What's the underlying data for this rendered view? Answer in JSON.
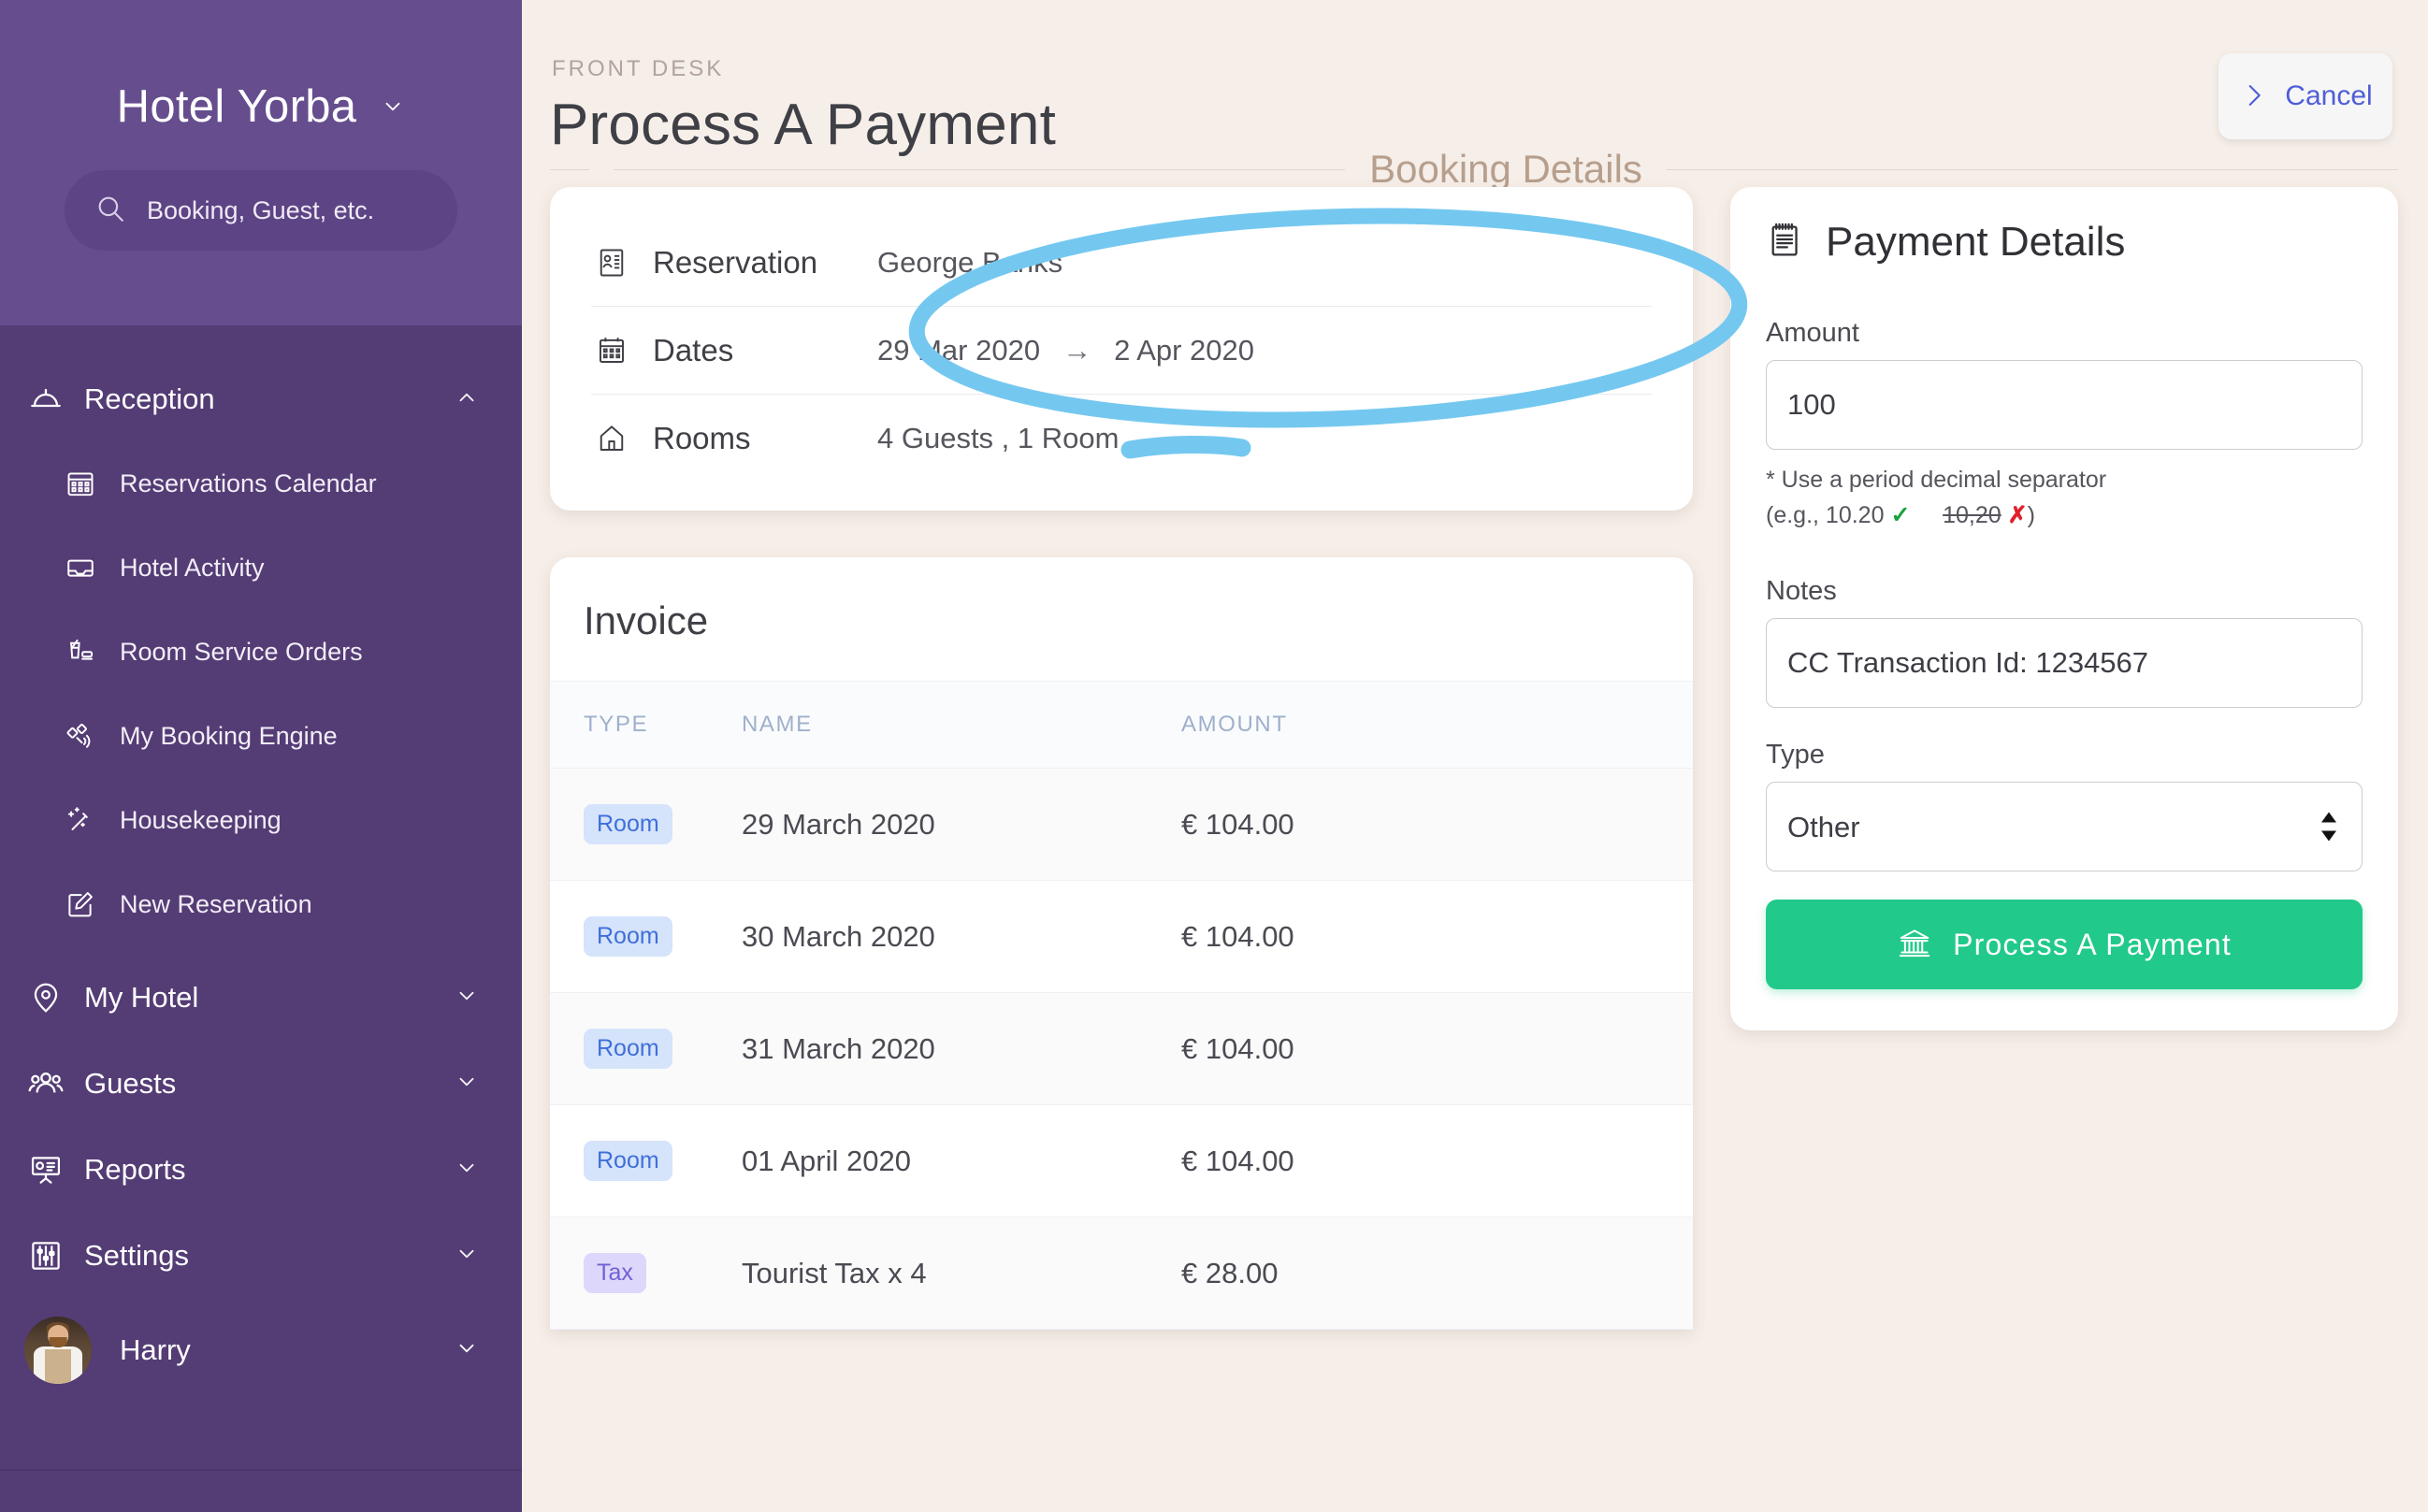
{
  "sidebar": {
    "brand": "Hotel Yorba",
    "brand_chevron_icon": "chevron-down-icon",
    "search": {
      "placeholder": "Booking, Guest, etc.",
      "icon": "search-icon"
    },
    "groups": [
      {
        "label": "Reception",
        "icon": "service-bell-icon",
        "expanded": true,
        "chevron": "chevron-up-icon",
        "items": [
          {
            "label": "Reservations Calendar",
            "icon": "calendar-icon"
          },
          {
            "label": "Hotel Activity",
            "icon": "inbox-icon"
          },
          {
            "label": "Room Service Orders",
            "icon": "room-service-icon"
          },
          {
            "label": "My Booking Engine",
            "icon": "satellite-icon"
          },
          {
            "label": "Housekeeping",
            "icon": "magic-wand-icon"
          },
          {
            "label": "New Reservation",
            "icon": "edit-document-icon"
          }
        ]
      },
      {
        "label": "My Hotel",
        "icon": "map-pin-icon",
        "expanded": false,
        "chevron": "chevron-down-icon",
        "items": []
      },
      {
        "label": "Guests",
        "icon": "people-icon",
        "expanded": false,
        "chevron": "chevron-down-icon",
        "items": []
      },
      {
        "label": "Reports",
        "icon": "presentation-chart-icon",
        "expanded": false,
        "chevron": "chevron-down-icon",
        "items": []
      },
      {
        "label": "Settings",
        "icon": "sliders-icon",
        "expanded": false,
        "chevron": "chevron-down-icon",
        "items": []
      }
    ],
    "user": {
      "name": "Harry",
      "avatar": "user-avatar",
      "chevron": "chevron-down-icon"
    }
  },
  "header": {
    "eyebrow": "FRONT DESK",
    "title": "Process A Payment",
    "cancel_label": "Cancel",
    "cancel_icon": "chevron-right-icon",
    "section_label": "Booking Details"
  },
  "booking": {
    "rows": [
      {
        "icon": "id-card-icon",
        "label": "Reservation",
        "value": "George Banks"
      },
      {
        "icon": "calendar-icon",
        "label": "Dates",
        "value_from": "29 Mar 2020",
        "arrow": "→",
        "value_to": "2 Apr 2020"
      },
      {
        "icon": "house-icon",
        "label": "Rooms",
        "value": "4   Guests , 1 Room"
      }
    ]
  },
  "invoice": {
    "title": "Invoice",
    "columns": [
      "TYPE",
      "NAME",
      "AMOUNT"
    ],
    "rows": [
      {
        "type": "Room",
        "type_class": "room",
        "name": "29 March 2020",
        "amount": "€ 104.00"
      },
      {
        "type": "Room",
        "type_class": "room",
        "name": "30 March 2020",
        "amount": "€ 104.00"
      },
      {
        "type": "Room",
        "type_class": "room",
        "name": "31 March 2020",
        "amount": "€ 104.00"
      },
      {
        "type": "Room",
        "type_class": "room",
        "name": "01 April 2020",
        "amount": "€ 104.00"
      },
      {
        "type": "Tax",
        "type_class": "tax",
        "name": "Tourist Tax x 4",
        "amount": "€ 28.00"
      }
    ]
  },
  "payment": {
    "title": "Payment Details",
    "title_icon": "notepad-icon",
    "amount_label": "Amount",
    "amount_value": "100",
    "hint_line1": "* Use a period decimal separator",
    "hint_prefix": "(e.g., 10.20",
    "hint_ok": "✓",
    "hint_bad_value": "10,20",
    "hint_bad": "✗",
    "hint_suffix": ")",
    "notes_label": "Notes",
    "notes_value": "CC Transaction Id: 1234567",
    "type_label": "Type",
    "type_value": "Other",
    "submit_label": "Process A Payment",
    "submit_icon": "bank-icon"
  },
  "colors": {
    "sidebar_dark": "#543c75",
    "sidebar_light": "#654d8e",
    "page_bg": "#f6eee8",
    "accent_green": "#21c98a",
    "accent_blue": "#4f5ed6",
    "chip_room": "#d5e3fb",
    "chip_tax": "#ddd7fb",
    "annotation": "#74c8f0"
  }
}
